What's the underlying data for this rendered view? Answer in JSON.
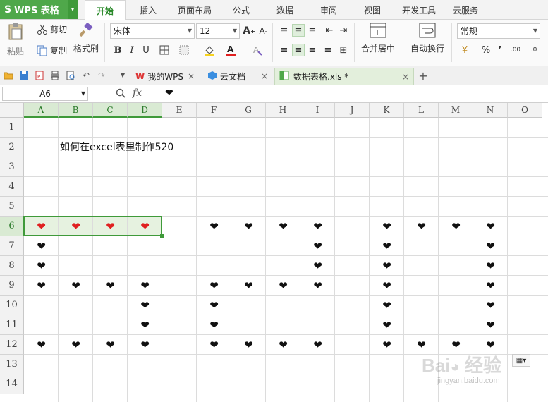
{
  "app": {
    "logo": "S",
    "name": "WPS 表格",
    "dropdown": "▾"
  },
  "menu": [
    "开始",
    "插入",
    "页面布局",
    "公式",
    "数据",
    "审阅",
    "视图",
    "开发工具",
    "云服务"
  ],
  "ribbon": {
    "paste": "粘贴",
    "cut": "剪切",
    "copy": "复制",
    "format_painter": "格式刷",
    "font_name": "宋体",
    "font_size": "12",
    "bold": "B",
    "italic": "I",
    "underline": "U",
    "merge_center": "合并居中",
    "wrap_text": "自动换行",
    "number_format": "常规",
    "percent": "%",
    "comma": "’",
    "inc_decimal": ".00",
    "dec_decimal": ".0"
  },
  "tabs": {
    "my_wps": "我的WPS",
    "cloud_docs": "云文档",
    "file": "数据表格.xls *",
    "close": "×",
    "add": "+"
  },
  "formula_bar": {
    "cell_ref": "A6",
    "fx": "fx",
    "content": "❤"
  },
  "grid": {
    "columns": [
      "A",
      "B",
      "C",
      "D",
      "E",
      "F",
      "G",
      "H",
      "I",
      "J",
      "K",
      "L",
      "M",
      "N",
      "O"
    ],
    "rows": [
      "1",
      "2",
      "3",
      "4",
      "5",
      "6",
      "7",
      "8",
      "9",
      "10",
      "11",
      "12",
      "13",
      "14"
    ],
    "selected_columns": [
      "A",
      "B",
      "C",
      "D"
    ],
    "selected_row": "6",
    "b2_text": "如何在excel表里制作520",
    "heart": "❤",
    "red_hearts": [
      "A6",
      "B6",
      "C6",
      "D6"
    ],
    "black_hearts": [
      "F6",
      "G6",
      "H6",
      "I6",
      "K6",
      "L6",
      "M6",
      "N6",
      "A7",
      "I7",
      "K7",
      "N7",
      "A8",
      "I8",
      "K8",
      "N8",
      "A9",
      "B9",
      "C9",
      "D9",
      "F9",
      "G9",
      "H9",
      "I9",
      "K9",
      "N9",
      "D10",
      "F10",
      "K10",
      "N10",
      "D11",
      "F11",
      "K11",
      "N11",
      "A12",
      "B12",
      "C12",
      "D12",
      "F12",
      "G12",
      "H12",
      "I12",
      "K12",
      "L12",
      "M12",
      "N12"
    ]
  },
  "watermark": {
    "text": "Baidu 经验",
    "url": "jingyan.baidu.com"
  },
  "colors": {
    "accent_green": "#4fa84a",
    "heart_red": "#e02020",
    "selection": "#3f9a3a"
  },
  "icons": [
    "scissors-icon",
    "copy-icon",
    "format-painter-icon",
    "save-icon",
    "print-icon",
    "undo-icon",
    "redo-icon",
    "search-icon",
    "wps-logo-icon",
    "cloud-icon",
    "spreadsheet-icon"
  ]
}
